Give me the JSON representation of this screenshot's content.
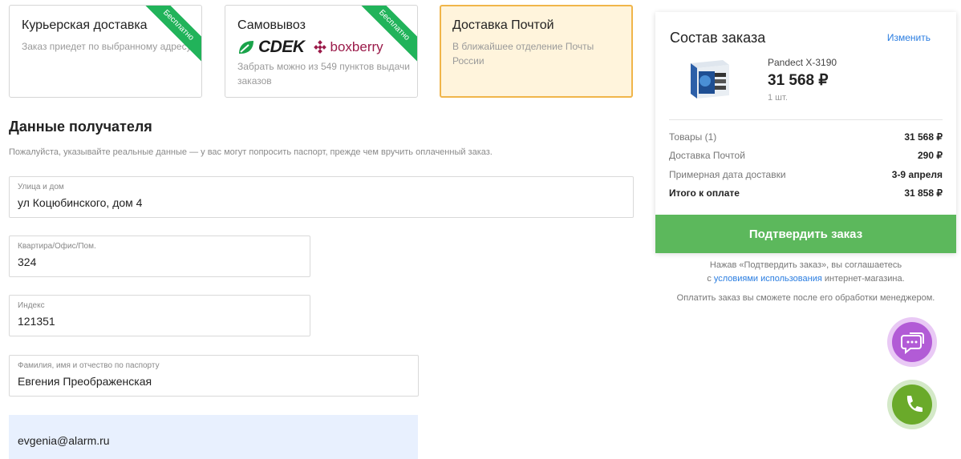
{
  "delivery": {
    "options": [
      {
        "title": "Курьерская доставка",
        "desc": "Заказ приедет по выбранному адресу",
        "badge": "Бесплатно"
      },
      {
        "title": "Самовывоз",
        "desc": "Забрать можно из 549 пунктов выдачи заказов",
        "badge": "Бесплатно",
        "logos": {
          "cdek": "CDEK",
          "boxberry": "boxberry"
        }
      },
      {
        "title": "Доставка Почтой",
        "desc": "В ближайшее отделение Почты России"
      }
    ],
    "selected_index": 2
  },
  "recipient": {
    "title": "Данные получателя",
    "note": "Пожалуйста, указывайте реальные данные — у вас могут попросить паспорт, прежде чем вручить оплаченный заказ.",
    "fields": [
      {
        "label": "Улица и дом",
        "value": "ул Коцюбинского, дом 4"
      },
      {
        "label": "Квартира/Офис/Пом.",
        "value": "324"
      },
      {
        "label": "Индекс",
        "value": "121351"
      },
      {
        "label": "Фамилия, имя и отчество по паспорту",
        "value": "Евгения Преображенская"
      }
    ],
    "email": "evgenia@alarm.ru"
  },
  "summary": {
    "title": "Состав заказа",
    "edit_label": "Изменить",
    "product": {
      "name": "Pandect X-3190",
      "price": "31 568 ₽",
      "qty": "1 шт."
    },
    "rows": [
      {
        "label": "Товары (1)",
        "value": "31 568 ₽"
      },
      {
        "label": "Доставка Почтой",
        "value": "290 ₽"
      },
      {
        "label": "Примерная дата доставки",
        "value": "3-9 апреля"
      },
      {
        "label": "Итого к оплате",
        "value": "31 858 ₽"
      }
    ],
    "confirm_label": "Подтвердить заказ",
    "agree_prefix": "Нажав «Подтвердить заказ», вы соглашаетесь",
    "agree_mid": "с",
    "agree_link": "условиями использования",
    "agree_suffix": "интернет-магазина.",
    "payment_note": "Оплатить заказ вы сможете после его обработки менеджером."
  },
  "colors": {
    "accent_green": "#5cb85c",
    "selected_border": "#f0b54a",
    "link": "#2a7de1",
    "chat": "#b25bd6",
    "phone": "#6aaa2a"
  },
  "icons": {
    "chat": "chat-bubbles-icon",
    "phone": "phone-icon"
  }
}
